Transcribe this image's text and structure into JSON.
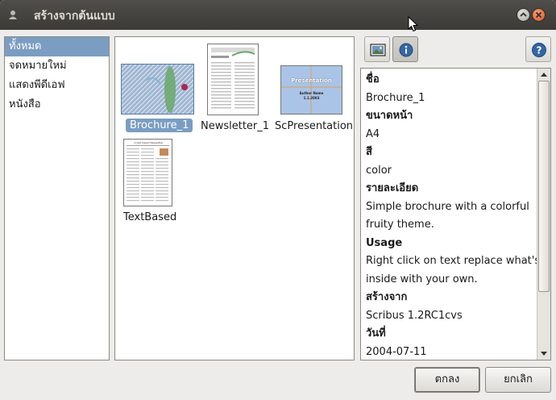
{
  "window": {
    "title": "สร้างจากต้นแบบ"
  },
  "categories": [
    {
      "label": "ทั้งหมด",
      "selected": true
    },
    {
      "label": "จดหมายใหม่",
      "selected": false
    },
    {
      "label": "แสดงพีดีเอฟ",
      "selected": false
    },
    {
      "label": "หนังสือ",
      "selected": false
    }
  ],
  "templates": [
    {
      "name": "Brochure_1",
      "selected": true
    },
    {
      "name": "Newsletter_1",
      "selected": false
    },
    {
      "name": "ScPresentation",
      "selected": false,
      "thumb_title": "Presentation",
      "thumb_author": "Author Name",
      "thumb_date": "1.1.2003"
    },
    {
      "name": "TextBased",
      "selected": false,
      "thumb_title": "A text based Newsletter"
    }
  ],
  "info": {
    "fields": [
      {
        "label": "ชื่อ",
        "value": "Brochure_1"
      },
      {
        "label": "ขนาดหน้า",
        "value": "A4"
      },
      {
        "label": "สี",
        "value": "color"
      },
      {
        "label": "รายละเอียด",
        "value": "Simple brochure with a colorful",
        "value2": "fruity theme."
      },
      {
        "label": "Usage",
        "value": "Right click on text replace what's",
        "value2": "inside with your own."
      },
      {
        "label": "สร้างจาก",
        "value": "Scribus 1.2RC1cvs"
      },
      {
        "label": "วันที่",
        "value": "2004-07-11"
      }
    ]
  },
  "buttons": {
    "ok": "ตกลง",
    "cancel": "ยกเลิก"
  },
  "colors": {
    "selection": "#7b9dc2",
    "titlebar": "#3c3b37",
    "close": "#e2511d"
  },
  "icons": {
    "tab_preview": "image-icon",
    "tab_info": "info-icon",
    "help": "help-icon"
  }
}
